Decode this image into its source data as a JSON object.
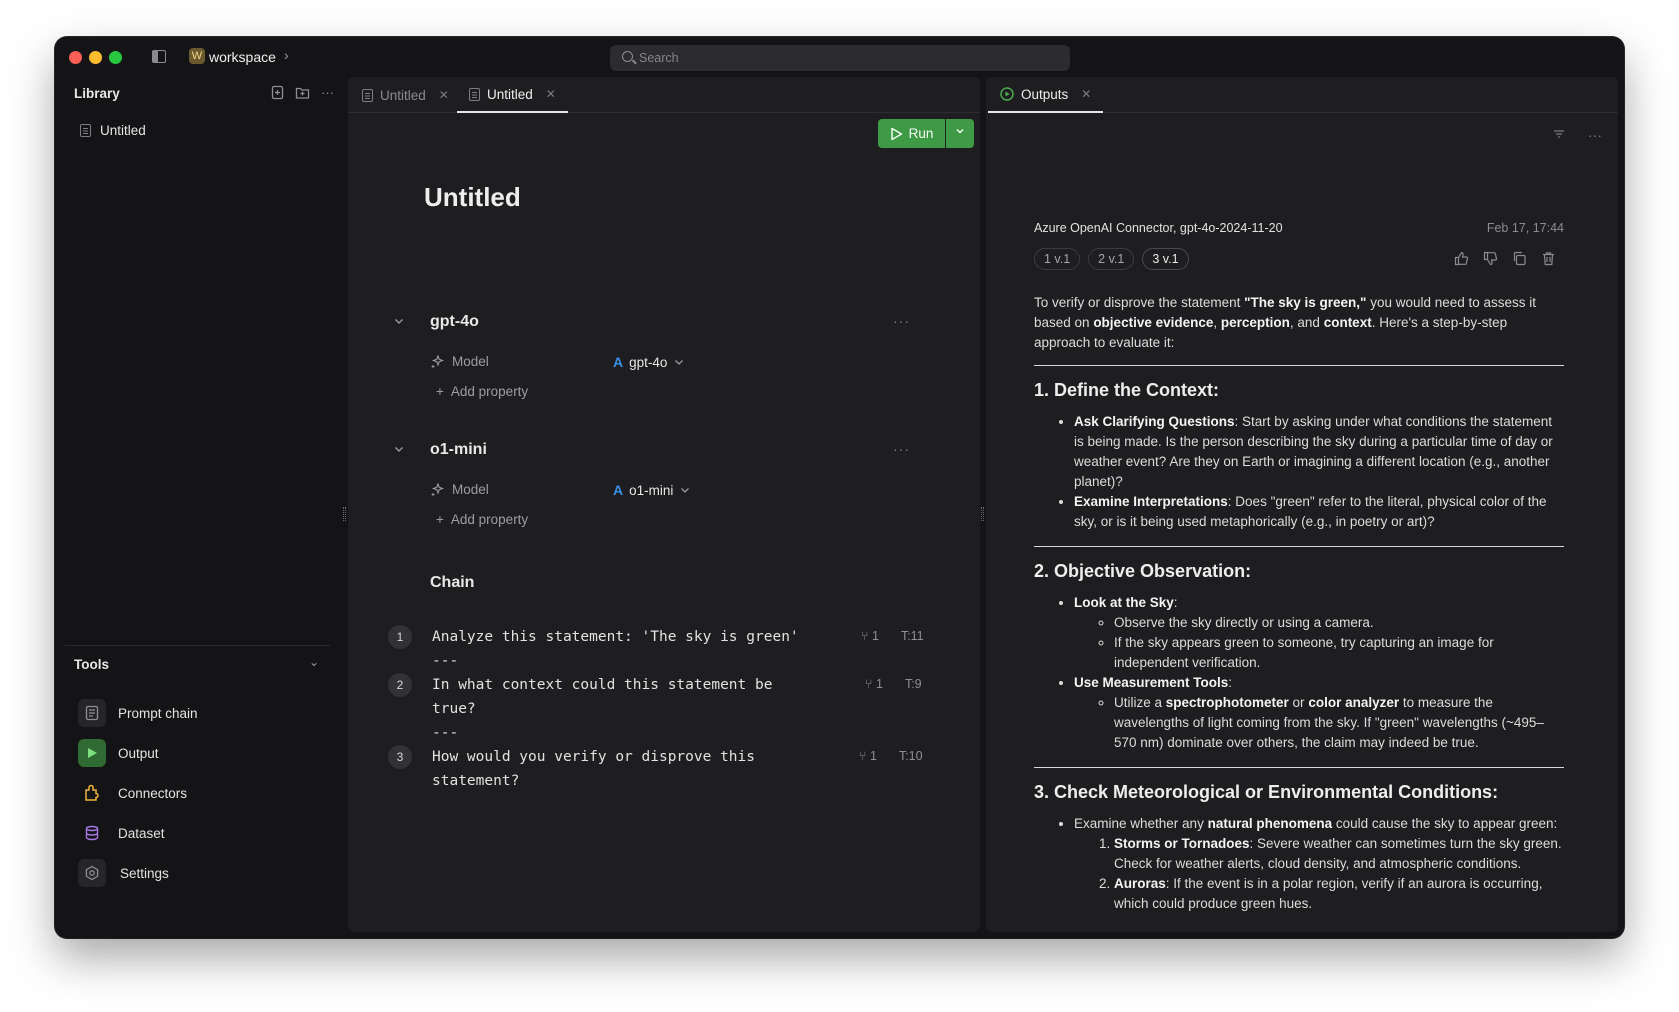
{
  "titlebar": {
    "workspace_badge": "W",
    "workspace_name": "workspace",
    "search_placeholder": "Search"
  },
  "library": {
    "title": "Library",
    "items": [
      {
        "label": "Untitled"
      }
    ]
  },
  "tools": {
    "title": "Tools",
    "items": [
      {
        "label": "Prompt chain",
        "icon": "prompt-chain-icon"
      },
      {
        "label": "Output",
        "icon": "output-icon"
      },
      {
        "label": "Connectors",
        "icon": "connectors-icon"
      },
      {
        "label": "Dataset",
        "icon": "dataset-icon"
      },
      {
        "label": "Settings",
        "icon": "settings-icon"
      }
    ]
  },
  "editor": {
    "tabs": [
      {
        "label": "Untitled",
        "active": false
      },
      {
        "label": "Untitled",
        "active": true
      }
    ],
    "run_label": "Run",
    "doc_title": "Untitled",
    "sections": [
      {
        "title": "gpt-4o",
        "property_label": "Model",
        "model": "gpt-4o",
        "add_property": "Add property"
      },
      {
        "title": "o1-mini",
        "property_label": "Model",
        "model": "o1-mini",
        "add_property": "Add property"
      }
    ],
    "chain": {
      "title": "Chain",
      "steps": [
        {
          "num": "1",
          "text": "Analyze this statement: 'The sky is green'\n---",
          "branches": "1",
          "tokens": "T:11"
        },
        {
          "num": "2",
          "text": "In what context could this statement be\ntrue?\n---",
          "branches": "1",
          "tokens": "T:9"
        },
        {
          "num": "3",
          "text": "How would you verify or disprove this\nstatement?",
          "branches": "1",
          "tokens": "T:10"
        }
      ]
    }
  },
  "outputs": {
    "tab_label": "Outputs",
    "meta": "Azure OpenAI Connector, gpt-4o-2024-11-20",
    "date": "Feb 17, 17:44",
    "versions": [
      "1 v.1",
      "2 v.1",
      "3 v.1"
    ],
    "intro": {
      "t1": "To verify or disprove the statement ",
      "b1": "\"The sky is green,\"",
      "t2": " you would need to assess it based on ",
      "b2": "objective evidence",
      "t3": ", ",
      "b3": "perception",
      "t4": ", and ",
      "b4": "context",
      "t5": ". Here's a step-by-step approach to evaluate it:"
    },
    "s1": {
      "heading": "1. Define the Context:",
      "li1_b": "Ask Clarifying Questions",
      "li1_t": ": Start by asking under what conditions the statement is being made. Is the person describing the sky during a particular time of day or weather event? Are they on Earth or imagining a different location (e.g., another planet)?",
      "li2_b": "Examine Interpretations",
      "li2_t": ": Does \"green\" refer to the literal, physical color of the sky, or is it being used metaphorically (e.g., in poetry or art)?"
    },
    "s2": {
      "heading": "2. Objective Observation:",
      "li1_b": "Look at the Sky",
      "li1_t": ":",
      "li1_sub1": "Observe the sky directly or using a camera.",
      "li1_sub2": "If the sky appears green to someone, try capturing an image for independent verification.",
      "li2_b": "Use Measurement Tools",
      "li2_t": ":",
      "li2_sub_t1": "Utilize a ",
      "li2_sub_b1": "spectrophotometer",
      "li2_sub_t2": " or ",
      "li2_sub_b2": "color analyzer",
      "li2_sub_t3": " to measure the wavelengths of light coming from the sky. If \"green\" wavelengths (~495–570 nm) dominate over others, the claim may indeed be true."
    },
    "s3": {
      "heading": "3. Check Meteorological or Environmental Conditions:",
      "li1_t1": "Examine whether any ",
      "li1_b": "natural phenomena",
      "li1_t2": " could cause the sky to appear green:",
      "ol1_b": "Storms or Tornadoes",
      "ol1_t": ": Severe weather can sometimes turn the sky green. Check for weather alerts, cloud density, and atmospheric conditions.",
      "ol2_b": "Auroras",
      "ol2_t": ": If the event is in a polar region, verify if an aurora is occurring, which could produce green hues."
    }
  },
  "colors": {
    "run_green": "#3f9a45",
    "azure_blue": "#3a8ee6",
    "traffic_red": "#fe5f57",
    "traffic_yellow": "#febc2e",
    "traffic_green": "#28c840"
  }
}
